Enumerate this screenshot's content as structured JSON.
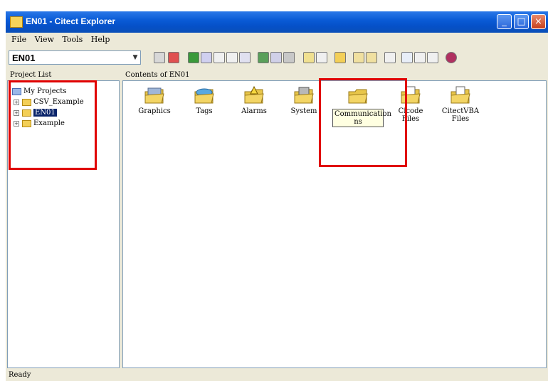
{
  "window": {
    "title": "EN01 - Citect Explorer"
  },
  "menu": [
    "File",
    "View",
    "Tools",
    "Help"
  ],
  "toolbar": {
    "project_combo_value": "EN01"
  },
  "left_pane": {
    "header": "Project List",
    "tree": [
      {
        "label": "My Projects",
        "selected": false
      },
      {
        "label": "CSV_Example",
        "selected": false
      },
      {
        "label": "EN01",
        "selected": true
      },
      {
        "label": "Example",
        "selected": false
      }
    ]
  },
  "right_pane": {
    "header": "Contents of EN01",
    "items": [
      {
        "label": "Graphics",
        "icon": "graphics-folder-icon"
      },
      {
        "label": "Tags",
        "icon": "tags-folder-icon"
      },
      {
        "label": "Alarms",
        "icon": "alarms-folder-icon"
      },
      {
        "label": "System",
        "icon": "system-folder-icon"
      },
      {
        "label": "Communication",
        "label2": "ns",
        "icon": "communication-folder-icon"
      },
      {
        "label": "Cicode Files",
        "icon": "cicode-files-icon"
      },
      {
        "label": "CitectVBA",
        "label2": "Files",
        "icon": "citectvba-files-icon"
      }
    ]
  },
  "status_bar": {
    "text": "Ready"
  },
  "colors": {
    "titlebar": "#0a5bd6",
    "selection": "#0a246a",
    "highlight_box": "#e00000"
  }
}
